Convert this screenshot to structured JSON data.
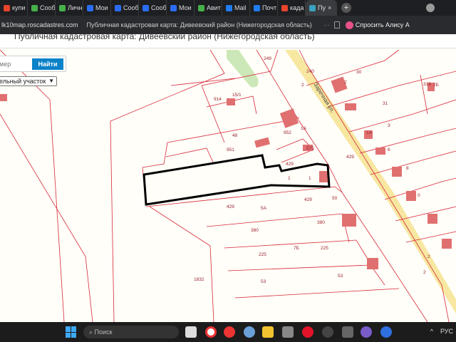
{
  "browser": {
    "tabs": [
      {
        "label": "купи",
        "icon": "yandex-icon",
        "color": "#e8442e"
      },
      {
        "label": "Сооб",
        "icon": "avito-icon",
        "color": "#46b04a"
      },
      {
        "label": "Личн",
        "icon": "avito-icon",
        "color": "#46b04a"
      },
      {
        "label": "Мои",
        "icon": "arrow-logo-icon",
        "color": "#2a6df4"
      },
      {
        "label": "Сооб",
        "icon": "arrow-logo-icon",
        "color": "#2a6df4"
      },
      {
        "label": "Сооб",
        "icon": "arrow-logo-icon",
        "color": "#2a6df4"
      },
      {
        "label": "Мои",
        "icon": "arrow-logo-icon",
        "color": "#2a6df4"
      },
      {
        "label": "Авит",
        "icon": "avito-icon",
        "color": "#46b04a"
      },
      {
        "label": "Mail",
        "icon": "mail-icon",
        "color": "#1f7cf2"
      },
      {
        "label": "Почт",
        "icon": "mail-icon",
        "color": "#1f7cf2"
      },
      {
        "label": "када",
        "icon": "yandex-icon",
        "color": "#e8442e"
      },
      {
        "label": "Пу",
        "icon": "cadastre-icon",
        "color": "#3aa0c0",
        "active": true
      }
    ],
    "url": "lk10map.roscadastres.com",
    "page_title": "Публичная кадастровая карта: Дивеевский район (Нижегородская область)",
    "alice_label": "Спросить Алису А"
  },
  "search": {
    "placeholder": "мер",
    "button": "Найти",
    "type_selected": "ельный участок"
  },
  "map": {
    "street": "Заречная ул.",
    "labels": [
      "914",
      "15/1",
      "48",
      "952",
      "1А",
      "951",
      "429",
      "575",
      "1",
      "1",
      "429",
      "5А",
      "429",
      "50",
      "380",
      "380",
      "225",
      "7Б",
      "225",
      "53",
      "1832",
      "53",
      "2",
      "30",
      "2",
      "31",
      "3",
      "1А",
      "6",
      "8",
      "318",
      "2Б",
      "0",
      "2",
      "240",
      "249",
      "429",
      "2"
    ],
    "colors": {
      "boundary": "#d8283a",
      "building": "#e07070",
      "road": "#f7e7a0",
      "selected": "#000000",
      "green": "#cde8b8"
    }
  },
  "taskbar": {
    "search": "Поиск",
    "lang": "РУС",
    "chevron": "^"
  }
}
